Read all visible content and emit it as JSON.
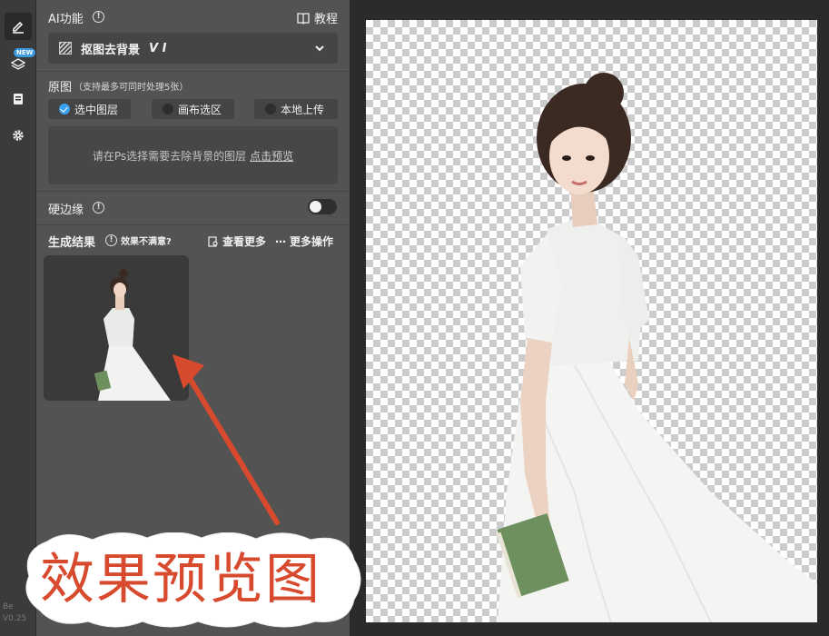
{
  "rail": {
    "items": [
      {
        "name": "edit-icon",
        "active": true
      },
      {
        "name": "layers-icon",
        "badge": "NEW"
      },
      {
        "name": "notes-icon"
      },
      {
        "name": "gear-icon"
      }
    ],
    "footer_line1": "Be",
    "footer_line2": "V0.25"
  },
  "ai": {
    "title": "AI功能",
    "tutorial_label": "教程",
    "dropdown": {
      "label": "抠图去背景",
      "version": "V I"
    }
  },
  "source": {
    "title": "原图",
    "hint": "（支持最多可同时处理5张）",
    "options": [
      {
        "label": "选中图层",
        "selected": true
      },
      {
        "label": "画布选区",
        "selected": false
      },
      {
        "label": "本地上传",
        "selected": false
      }
    ],
    "dropzone_text": "请在Ps选择需要去除背景的图层",
    "dropzone_link": "点击预览"
  },
  "hard_edge": {
    "title": "硬边缘",
    "enabled": false
  },
  "result": {
    "title": "生成结果",
    "unsatisfied": "效果不满意?",
    "view_more": "查看更多",
    "more_actions": "更多操作"
  },
  "annotation": {
    "text": "效果预览图",
    "color": "#d84a2e"
  },
  "colors": {
    "accent": "#3aa0f0",
    "panel": "#535353",
    "rail": "#3b3b3b"
  }
}
